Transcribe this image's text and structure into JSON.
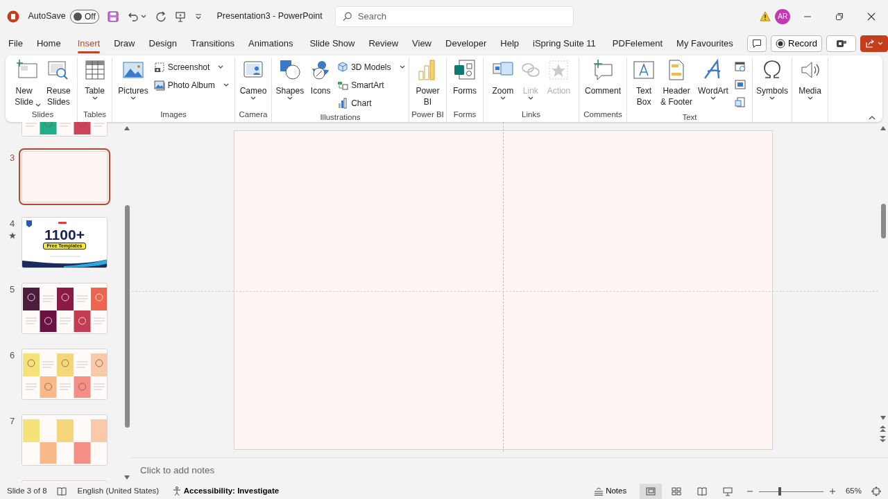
{
  "title_bar": {
    "autosave": {
      "label": "AutoSave",
      "state": "Off",
      "on": false
    },
    "title": "Presentation3  -  PowerPoint",
    "search": {
      "placeholder": "Search"
    },
    "account": {
      "initials": "AR"
    }
  },
  "tabs": [
    {
      "label": "File",
      "selected": false
    },
    {
      "label": "Home",
      "selected": false
    },
    {
      "label": "Insert",
      "selected": true
    },
    {
      "label": "Draw",
      "selected": false
    },
    {
      "label": "Design",
      "selected": false
    },
    {
      "label": "Transitions",
      "selected": false
    },
    {
      "label": "Animations",
      "selected": false
    },
    {
      "label": "Slide Show",
      "selected": false
    },
    {
      "label": "Review",
      "selected": false
    },
    {
      "label": "View",
      "selected": false
    },
    {
      "label": "Developer",
      "selected": false
    },
    {
      "label": "Help",
      "selected": false
    },
    {
      "label": "iSpring Suite 11",
      "selected": false
    },
    {
      "label": "PDFelement",
      "selected": false
    },
    {
      "label": "My Favourites",
      "selected": false
    }
  ],
  "tab_actions": {
    "record": "Record"
  },
  "ribbon": {
    "groups": [
      {
        "label": "Slides",
        "items": [
          {
            "kind": "large",
            "label": "New\nSlide",
            "dropdown": true,
            "disabled": false
          },
          {
            "kind": "large",
            "label": "Reuse\nSlides",
            "disabled": false
          }
        ]
      },
      {
        "label": "Tables",
        "items": [
          {
            "kind": "large",
            "label": "Table",
            "dropdown": true,
            "disabled": false
          }
        ]
      },
      {
        "label": "Images",
        "items": [
          {
            "kind": "large",
            "label": "Pictures",
            "dropdown": true,
            "disabled": false
          },
          {
            "kind": "small",
            "label": "Screenshot",
            "dropdown": true,
            "disabled": false
          },
          {
            "kind": "small",
            "label": "Photo Album",
            "dropdown": true,
            "disabled": false
          }
        ]
      },
      {
        "label": "Camera",
        "items": [
          {
            "kind": "large",
            "label": "Cameo",
            "dropdown": true,
            "disabled": false
          }
        ]
      },
      {
        "label": "Illustrations",
        "items": [
          {
            "kind": "large",
            "label": "Shapes",
            "dropdown": true,
            "disabled": false
          },
          {
            "kind": "large",
            "label": "Icons",
            "disabled": false
          },
          {
            "kind": "small",
            "label": "3D Models",
            "dropdown": true,
            "disabled": false
          },
          {
            "kind": "small",
            "label": "SmartArt",
            "disabled": false
          },
          {
            "kind": "small",
            "label": "Chart",
            "disabled": false
          }
        ]
      },
      {
        "label": "Power BI",
        "items": [
          {
            "kind": "large",
            "label": "Power\nBI",
            "disabled": false
          }
        ]
      },
      {
        "label": "Forms",
        "items": [
          {
            "kind": "large",
            "label": "Forms",
            "disabled": false
          }
        ]
      },
      {
        "label": "Links",
        "items": [
          {
            "kind": "large",
            "label": "Zoom",
            "dropdown": true,
            "disabled": false
          },
          {
            "kind": "large",
            "label": "Link",
            "dropdown": true,
            "disabled": true
          },
          {
            "kind": "large",
            "label": "Action",
            "disabled": true
          }
        ]
      },
      {
        "label": "Comments",
        "items": [
          {
            "kind": "large",
            "label": "Comment",
            "disabled": false
          }
        ]
      },
      {
        "label": "Text",
        "items": [
          {
            "kind": "large",
            "label": "Text\nBox",
            "disabled": false
          },
          {
            "kind": "large",
            "label": "Header\n& Footer",
            "disabled": false
          },
          {
            "kind": "large",
            "label": "WordArt",
            "dropdown": true,
            "disabled": false
          },
          {
            "kind": "icon",
            "disabled": false
          },
          {
            "kind": "icon",
            "disabled": false
          },
          {
            "kind": "icon",
            "disabled": false
          }
        ]
      },
      {
        "items": [
          {
            "kind": "large",
            "label": "Symbols",
            "dropdown": true,
            "disabled": false
          }
        ]
      },
      {
        "items": [
          {
            "kind": "large",
            "label": "Media",
            "dropdown": true,
            "disabled": false
          }
        ]
      }
    ]
  },
  "slides": [
    {
      "kind": "grid-mixed",
      "selected": false
    },
    {
      "number": "3",
      "kind": "blank",
      "selected": true,
      "animated": false
    },
    {
      "number": "4",
      "kind": "title",
      "title": "1100+",
      "badge": "Free Templates",
      "selected": false,
      "animated": true
    },
    {
      "number": "5",
      "kind": "grid-dark",
      "selected": false,
      "animated": false
    },
    {
      "number": "6",
      "kind": "grid-light",
      "selected": false,
      "animated": false
    },
    {
      "number": "7",
      "kind": "blocks",
      "selected": false,
      "animated": false
    },
    {
      "kind": "blank",
      "selected": false
    }
  ],
  "notes": {
    "placeholder": "Click to add notes"
  },
  "status_bar": {
    "slide": "Slide 3 of 8",
    "language": "English (United States)",
    "accessibility": "Accessibility: Investigate",
    "notes": "Notes",
    "views": [
      {
        "kind": "normal",
        "selected": true
      },
      {
        "kind": "sorter",
        "selected": false
      },
      {
        "kind": "reading",
        "selected": false
      },
      {
        "kind": "slideshow",
        "selected": false
      }
    ],
    "zoom": {
      "level": 0.33,
      "reading": "65%"
    }
  }
}
